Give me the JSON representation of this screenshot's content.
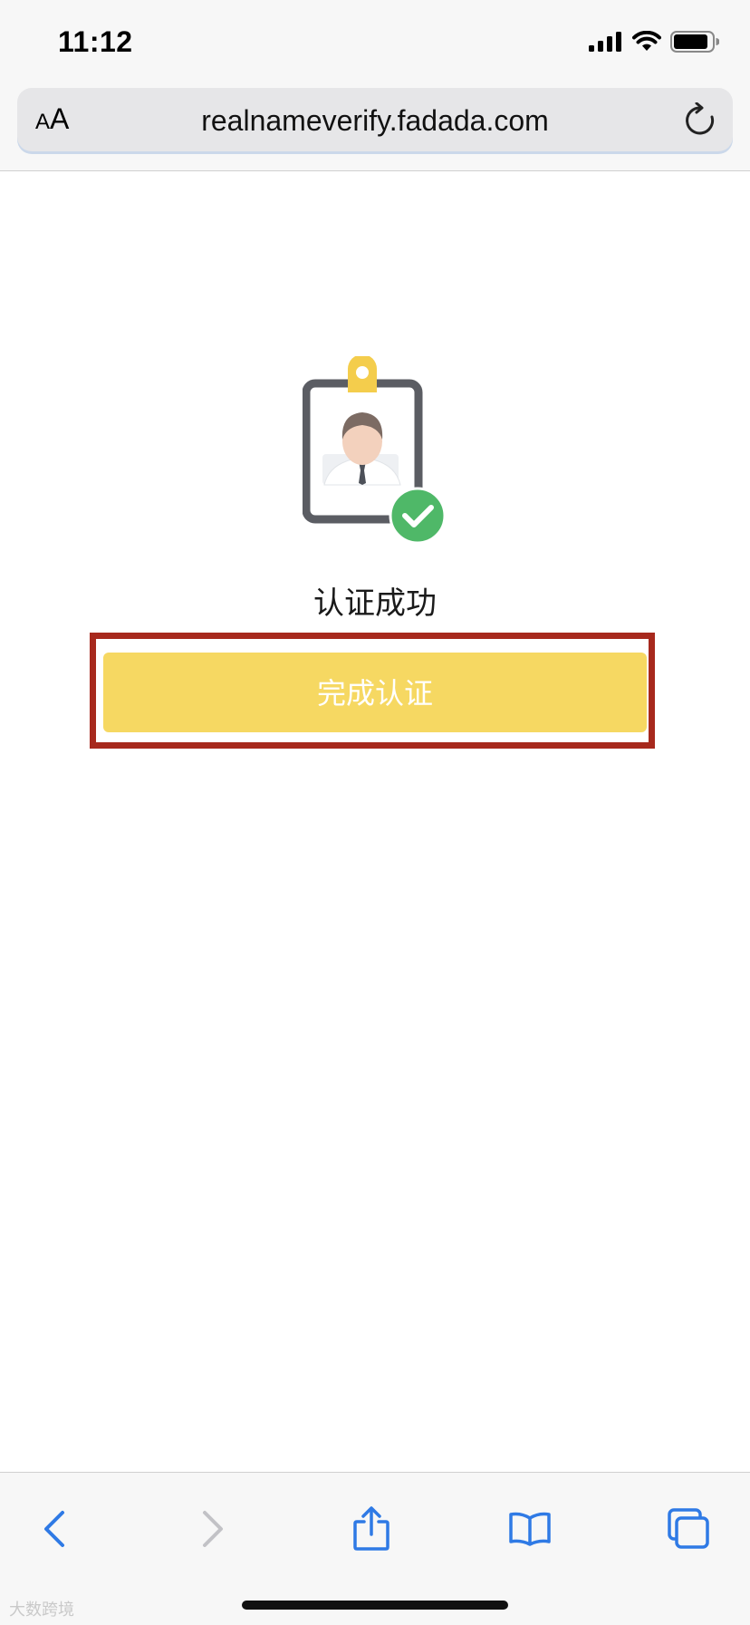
{
  "status_bar": {
    "time": "11:12",
    "icons": [
      "signal-icon",
      "wifi-icon",
      "battery-icon"
    ]
  },
  "browser": {
    "aa_label_small": "A",
    "aa_label_large": "A",
    "url": "realnameverify.fadada.com",
    "reload_icon": "reload-icon"
  },
  "content": {
    "illustration": "id-badge-check-icon",
    "success_message": "认证成功",
    "complete_button_label": "完成认证"
  },
  "toolbar": {
    "items": [
      "back-icon",
      "forward-icon",
      "share-icon",
      "bookmarks-icon",
      "tabs-icon"
    ]
  },
  "watermark": "大数跨境",
  "colors": {
    "button_yellow": "#f6d862",
    "highlight_red": "#a7291d",
    "check_green": "#4fb868",
    "ios_blue": "#2f7ae5",
    "badge_clip": "#f4cd4c"
  }
}
